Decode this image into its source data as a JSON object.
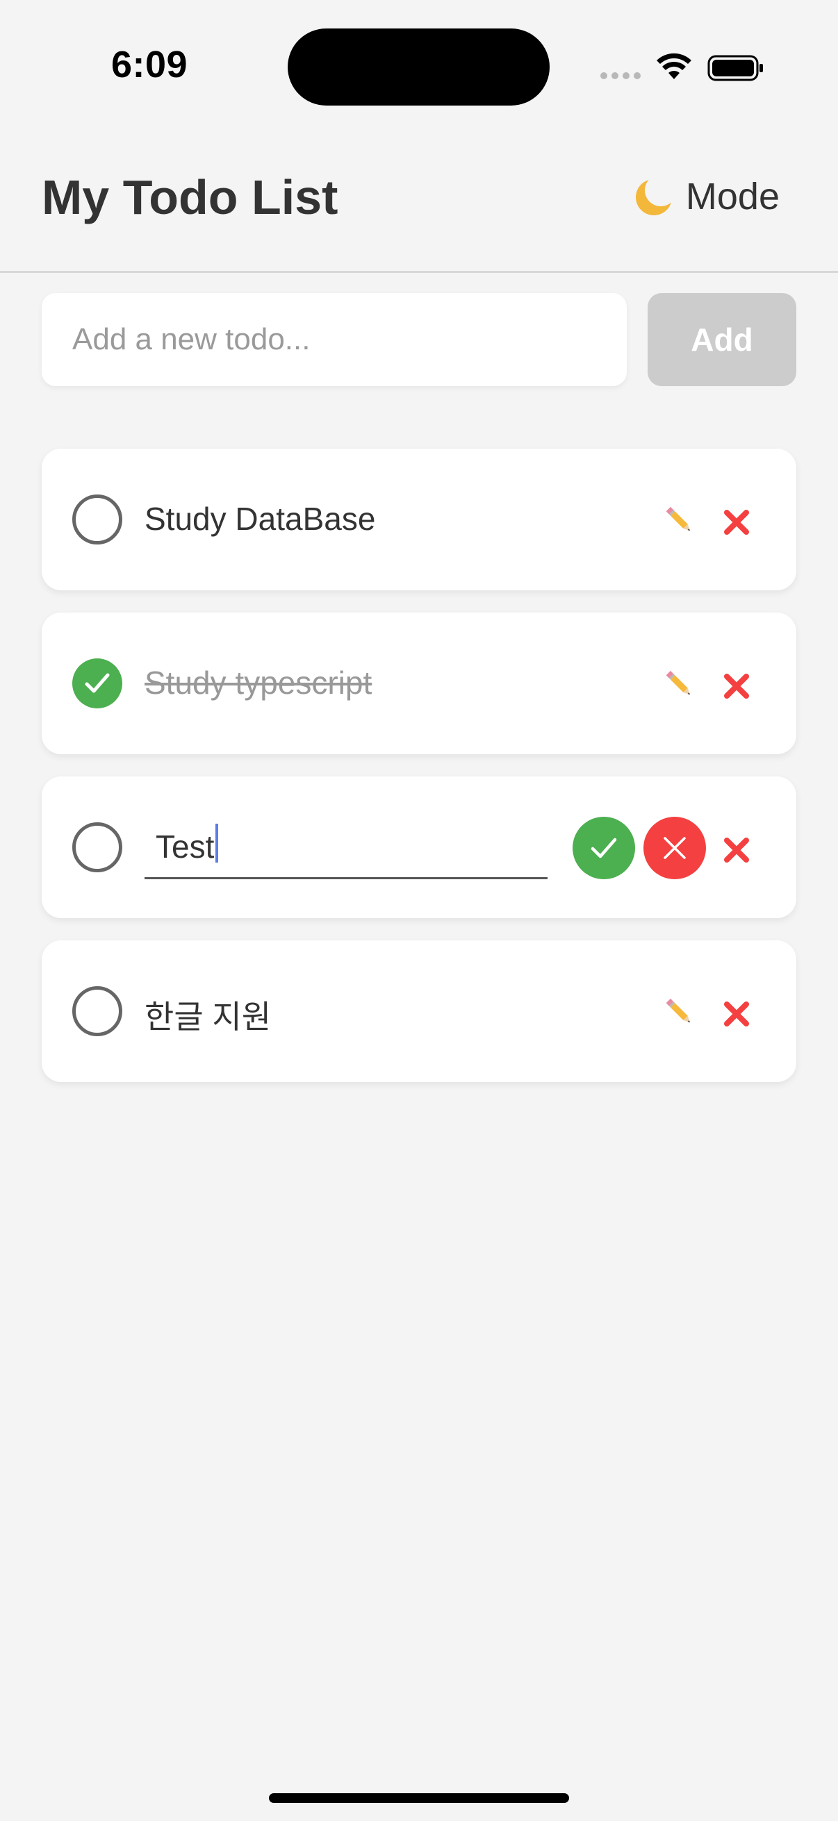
{
  "status_bar": {
    "time": "6:09"
  },
  "header": {
    "title": "My Todo List",
    "mode_label": "Mode",
    "mode_icon": "moon-icon"
  },
  "new_todo": {
    "placeholder": "Add a new todo...",
    "value": "",
    "add_label": "Add"
  },
  "todos": [
    {
      "text": "Study DataBase",
      "completed": false,
      "editing": false
    },
    {
      "text": "Study typescript",
      "completed": true,
      "editing": false
    },
    {
      "text": "Test",
      "completed": false,
      "editing": true
    },
    {
      "text": "한글 지원",
      "completed": false,
      "editing": false
    }
  ],
  "colors": {
    "background": "#f4f4f4",
    "card": "#ffffff",
    "complete_green": "#4caf50",
    "delete_red": "#f44040",
    "add_button_disabled": "#cccccc",
    "caret_blue": "#5b7de8"
  }
}
